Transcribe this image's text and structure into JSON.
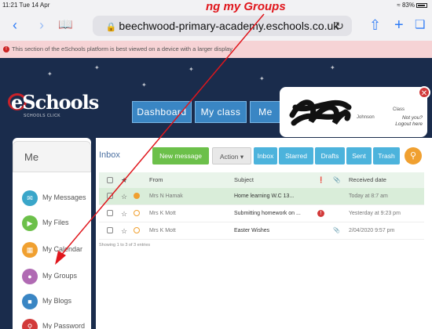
{
  "status_bar": {
    "time": "11:21",
    "date": "Tue 14 Apr",
    "battery": "83%"
  },
  "browser": {
    "url": "beechwood-primary-academy.eschools.co.uk",
    "icons": [
      "back-icon",
      "forward-icon",
      "bookmarks-icon",
      "lock-icon",
      "reload-icon",
      "share-icon",
      "new-tab-icon",
      "tabs-icon"
    ]
  },
  "annotation": {
    "text": "ng my Groups",
    "color": "#e0161c"
  },
  "notice": {
    "text": "This section of the eSchools platform is best viewed on a device with a larger display"
  },
  "header": {
    "logo": "eSchools",
    "logo_sub": "SCHOOLS CLICK",
    "nav": [
      "Dashboard",
      "My class",
      "Me"
    ],
    "user": {
      "name_tail": "Johnson",
      "class_label": "Class",
      "not_you": "Not you?",
      "logout": "Logout here"
    }
  },
  "sidebar": {
    "title": "Me",
    "items": [
      {
        "label": "My Messages",
        "icon": "envelope-icon",
        "color": "#3aa6c9"
      },
      {
        "label": "My Files",
        "icon": "folder-icon",
        "color": "#6cc04a"
      },
      {
        "label": "My Calendar",
        "icon": "calendar-icon",
        "color": "#f0a030"
      },
      {
        "label": "My Groups",
        "icon": "groups-icon",
        "color": "#b06ab3"
      },
      {
        "label": "My Blogs",
        "icon": "blog-icon",
        "color": "#3a86c4"
      },
      {
        "label": "My Password",
        "icon": "key-icon",
        "color": "#d23a3a"
      }
    ]
  },
  "inbox": {
    "title": "Inbox",
    "new_message": "New message",
    "action": "Action",
    "filters": [
      "Inbox",
      "Starred",
      "Drafts",
      "Sent",
      "Trash"
    ],
    "columns": {
      "from": "From",
      "subject": "Subject",
      "received": "Received date"
    },
    "rows": [
      {
        "from": "Mrs N Hamak",
        "subject": "Home learning   W.C 13...",
        "received": "Today at 8:7 am",
        "flag": "#f0a030",
        "alert": false,
        "attachment": false
      },
      {
        "from": "Mrs K Mott",
        "subject": "Submitting homework on ...",
        "received": "Yesterday at 9:23 pm",
        "flag": "#f7c46a",
        "alert": true,
        "attachment": false
      },
      {
        "from": "Mrs K Mott",
        "subject": "Easter Wishes",
        "received": "2/04/2020 9:57 pm",
        "flag": "#f7c46a",
        "alert": false,
        "attachment": true
      }
    ],
    "showing": "Showing 1 to 3 of 3 entries"
  }
}
